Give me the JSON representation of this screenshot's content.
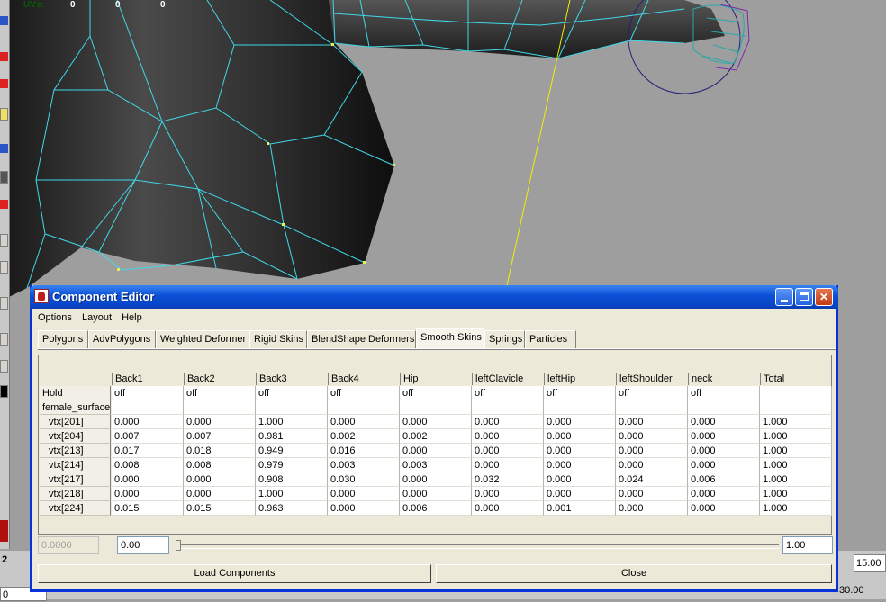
{
  "hud": {
    "label": "UVs:",
    "values": [
      "0",
      "0",
      "0"
    ]
  },
  "time_fields": {
    "current": "15.00",
    "end": "30.00",
    "left_frame": "2",
    "left_start": "0"
  },
  "dialog": {
    "title": "Component Editor",
    "menu": [
      "Options",
      "Layout",
      "Help"
    ],
    "tabs": [
      "Polygons",
      "AdvPolygons",
      "Weighted Deformer",
      "Rigid Skins",
      "BlendShape Deformers",
      "Smooth Skins",
      "Springs",
      "Particles"
    ],
    "active_tab": "Smooth Skins",
    "table": {
      "columns": [
        "Back1",
        "Back2",
        "Back3",
        "Back4",
        "Hip",
        "leftClavicle",
        "leftHip",
        "leftShoulder",
        "neck",
        "Total"
      ],
      "hold_label": "Hold",
      "hold": [
        "off",
        "off",
        "off",
        "off",
        "off",
        "off",
        "off",
        "off",
        "off",
        ""
      ],
      "surface_label": "female_surface",
      "rows": [
        {
          "label": "vtx[201]",
          "values": [
            "0.000",
            "0.000",
            "1.000",
            "0.000",
            "0.000",
            "0.000",
            "0.000",
            "0.000",
            "0.000",
            "1.000"
          ]
        },
        {
          "label": "vtx[204]",
          "values": [
            "0.007",
            "0.007",
            "0.981",
            "0.002",
            "0.002",
            "0.000",
            "0.000",
            "0.000",
            "0.000",
            "1.000"
          ]
        },
        {
          "label": "vtx[213]",
          "values": [
            "0.017",
            "0.018",
            "0.949",
            "0.016",
            "0.000",
            "0.000",
            "0.000",
            "0.000",
            "0.000",
            "1.000"
          ]
        },
        {
          "label": "vtx[214]",
          "values": [
            "0.008",
            "0.008",
            "0.979",
            "0.003",
            "0.003",
            "0.000",
            "0.000",
            "0.000",
            "0.000",
            "1.000"
          ]
        },
        {
          "label": "vtx[217]",
          "values": [
            "0.000",
            "0.000",
            "0.908",
            "0.030",
            "0.000",
            "0.032",
            "0.000",
            "0.024",
            "0.006",
            "1.000"
          ]
        },
        {
          "label": "vtx[218]",
          "values": [
            "0.000",
            "0.000",
            "1.000",
            "0.000",
            "0.000",
            "0.000",
            "0.000",
            "0.000",
            "0.000",
            "1.000"
          ]
        },
        {
          "label": "vtx[224]",
          "values": [
            "0.015",
            "0.015",
            "0.963",
            "0.000",
            "0.006",
            "0.000",
            "0.001",
            "0.000",
            "0.000",
            "1.000"
          ]
        }
      ]
    },
    "slider": {
      "field_value": "0.0000",
      "min": "0.00",
      "max": "1.00",
      "level": 0
    },
    "buttons": {
      "load": "Load Components",
      "close": "Close"
    }
  },
  "colors": {
    "title_blue": "#0a4fd4",
    "wireframe": "#40d8e8",
    "viewport_bg": "#9e9e9e",
    "mesh": "#2e2e2e"
  }
}
